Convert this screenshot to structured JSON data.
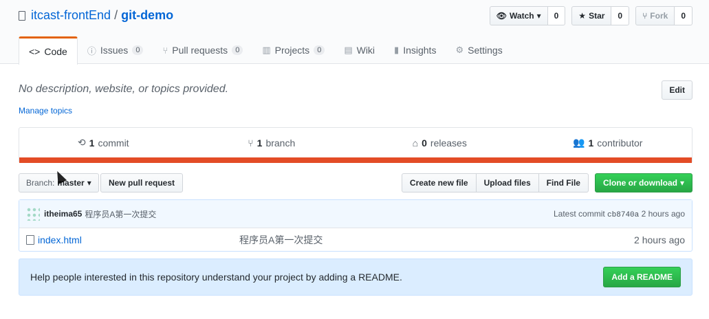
{
  "repo": {
    "owner": "itcast-frontEnd",
    "separator": "/",
    "name": "git-demo"
  },
  "actions": {
    "watch": {
      "label": "Watch",
      "count": "0"
    },
    "star": {
      "label": "Star",
      "count": "0"
    },
    "fork": {
      "label": "Fork",
      "count": "0"
    }
  },
  "tabs": [
    {
      "label": "Code",
      "icon": "code-icon",
      "glyph": "<>"
    },
    {
      "label": "Issues",
      "icon": "issue-icon",
      "glyph": "ⓘ",
      "count": "0"
    },
    {
      "label": "Pull requests",
      "icon": "pull-request-icon",
      "glyph": "⑂",
      "count": "0"
    },
    {
      "label": "Projects",
      "icon": "project-icon",
      "glyph": "▥",
      "count": "0"
    },
    {
      "label": "Wiki",
      "icon": "book-icon",
      "glyph": "▤"
    },
    {
      "label": "Insights",
      "icon": "graph-icon",
      "glyph": "▮"
    },
    {
      "label": "Settings",
      "icon": "gear-icon",
      "glyph": "⚙"
    }
  ],
  "description": "No description, website, or topics provided.",
  "edit_label": "Edit",
  "manage_topics": "Manage topics",
  "summary": {
    "commits": {
      "count": "1",
      "label": "commit"
    },
    "branches": {
      "count": "1",
      "label": "branch"
    },
    "releases": {
      "count": "0",
      "label": "releases"
    },
    "contributors": {
      "count": "1",
      "label": "contributor"
    },
    "language_color": "#e34c26"
  },
  "branch_select": {
    "label": "Branch:",
    "value": "master"
  },
  "new_pull_request": "New pull request",
  "file_buttons": [
    "Create new file",
    "Upload files",
    "Find File"
  ],
  "clone_button": "Clone or download",
  "latest_commit": {
    "author": "itheima65",
    "message": "程序员A第一次提交",
    "prefix": "Latest commit",
    "sha": "cb8740a",
    "age": "2 hours ago"
  },
  "files": [
    {
      "name": "index.html",
      "message": "程序员A第一次提交",
      "age": "2 hours ago"
    }
  ],
  "readme_prompt": {
    "text": "Help people interested in this repository understand your project by adding a README.",
    "button": "Add a README"
  },
  "colors": {
    "accent": "#0366d6",
    "success": "#28a745",
    "tab_highlight": "#e36209"
  }
}
